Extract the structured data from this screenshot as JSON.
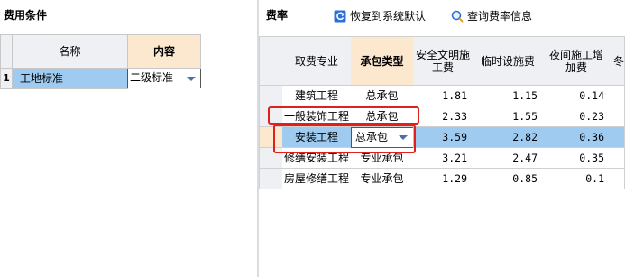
{
  "left": {
    "title": "费用条件",
    "columns": {
      "name": "名称",
      "content": "内容"
    },
    "rows": [
      {
        "num": "1",
        "name": "工地标准",
        "content": "二级标准"
      }
    ]
  },
  "right": {
    "title": "费率",
    "buttons": {
      "restore": "恢复到系统默认",
      "query": "查询费率信息"
    },
    "columns": {
      "major": "取费专业",
      "contract": "承包类型",
      "safety_l1": "安全文明施",
      "safety_l2": "工费",
      "temp": "临时设施费",
      "night_l1": "夜间施工增",
      "night_l2": "加费",
      "winter": "冬"
    },
    "rows": [
      {
        "major": "建筑工程",
        "contract": "总承包",
        "safety": "1.81",
        "temp": "1.15",
        "night": "0.14"
      },
      {
        "major": "一般装饰工程",
        "contract": "总承包",
        "safety": "2.33",
        "temp": "1.55",
        "night": "0.23"
      },
      {
        "major": "安装工程",
        "contract": "总承包",
        "safety": "3.59",
        "temp": "2.82",
        "night": "0.36"
      },
      {
        "major": "修缮安装工程",
        "contract": "专业承包",
        "safety": "3.21",
        "temp": "2.47",
        "night": "0.35"
      },
      {
        "major": "房屋修缮工程",
        "contract": "专业承包",
        "safety": "1.29",
        "temp": "0.85",
        "night": "0.1"
      }
    ]
  },
  "colors": {
    "selected_row": "#9fcbf0",
    "selected_header": "#fbe8cf",
    "highlight_box": "#e0201a",
    "accent": "#2c6fd6"
  },
  "icons": {
    "restore": "restore-icon",
    "query": "search-icon",
    "dropdown": "chevron-down-icon"
  }
}
